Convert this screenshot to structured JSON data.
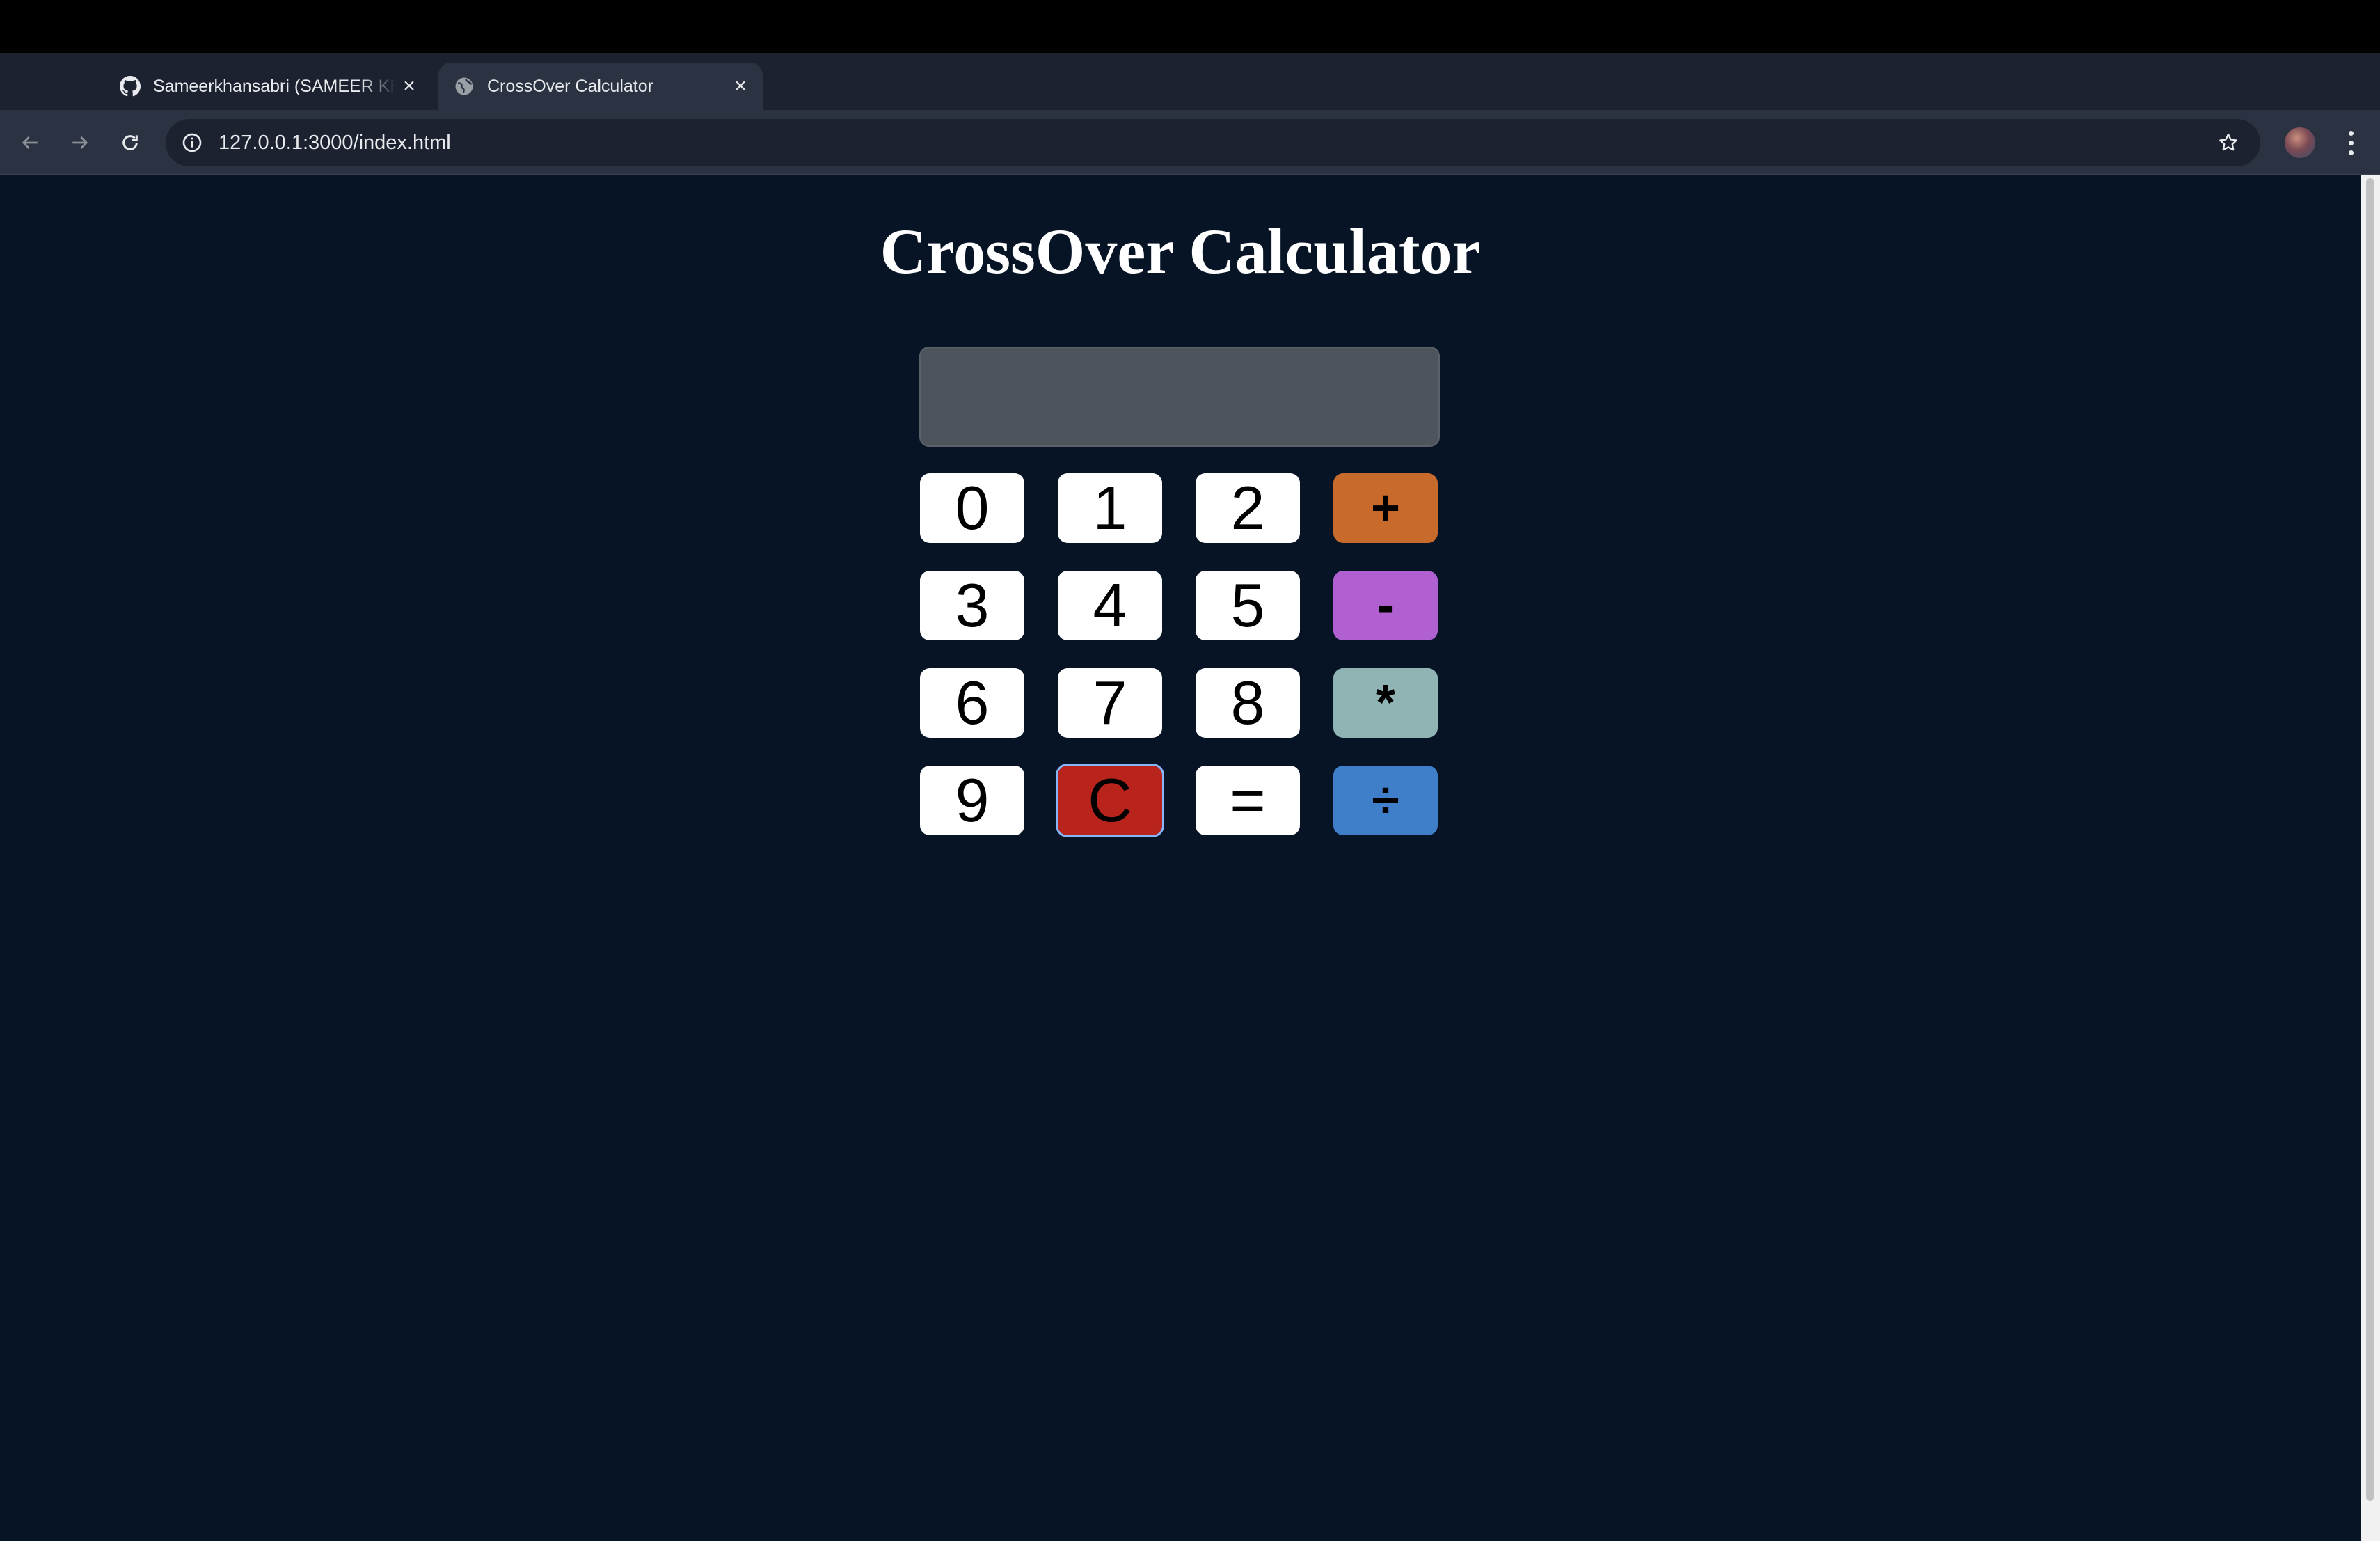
{
  "browser": {
    "tabs": [
      {
        "title": "Sameerkhansabri (SAMEER KHAN)",
        "favicon": "github-icon",
        "active": false
      },
      {
        "title": "CrossOver Calculator",
        "favicon": "globe-icon",
        "active": true
      }
    ],
    "url": "127.0.0.1:3000/index.html"
  },
  "page": {
    "title": "CrossOver Calculator",
    "display_value": ""
  },
  "keys": [
    {
      "label": "0",
      "color": "#ffffff"
    },
    {
      "label": "1",
      "color": "#ffffff"
    },
    {
      "label": "2",
      "color": "#ffffff"
    },
    {
      "label": "+",
      "color": "#c86a2c"
    },
    {
      "label": "3",
      "color": "#ffffff"
    },
    {
      "label": "4",
      "color": "#ffffff"
    },
    {
      "label": "5",
      "color": "#ffffff"
    },
    {
      "label": "-",
      "color": "#b160d1"
    },
    {
      "label": "6",
      "color": "#ffffff"
    },
    {
      "label": "7",
      "color": "#ffffff"
    },
    {
      "label": "8",
      "color": "#ffffff"
    },
    {
      "label": "*",
      "color": "#8fb4b3"
    },
    {
      "label": "9",
      "color": "#ffffff"
    },
    {
      "label": "C",
      "color": "#b8231b"
    },
    {
      "label": "=",
      "color": "#ffffff"
    },
    {
      "label": "÷",
      "color": "#3f7ec9"
    }
  ],
  "colors": {
    "page_background": "#061426",
    "display_background": "#4d545b"
  }
}
